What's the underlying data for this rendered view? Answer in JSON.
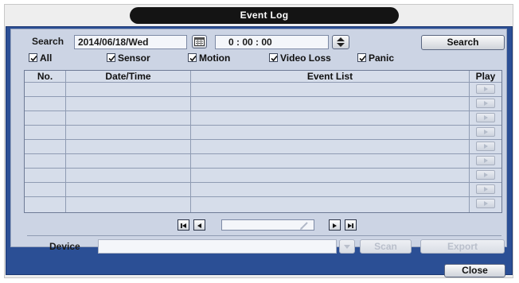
{
  "title": "Event Log",
  "search": {
    "label": "Search",
    "date": "2014/06/18/Wed",
    "time": "0 : 00 : 00",
    "button": "Search"
  },
  "filters": [
    {
      "label": "All",
      "checked": true
    },
    {
      "label": "Sensor",
      "checked": true
    },
    {
      "label": "Motion",
      "checked": true
    },
    {
      "label": "Video Loss",
      "checked": true
    },
    {
      "label": "Panic",
      "checked": true
    }
  ],
  "table": {
    "columns": [
      "No.",
      "Date/Time",
      "Event List",
      "Play"
    ],
    "rows": 9
  },
  "device": {
    "label": "Device",
    "value": "",
    "scan": "Scan",
    "export": "Export"
  },
  "close": "Close"
}
